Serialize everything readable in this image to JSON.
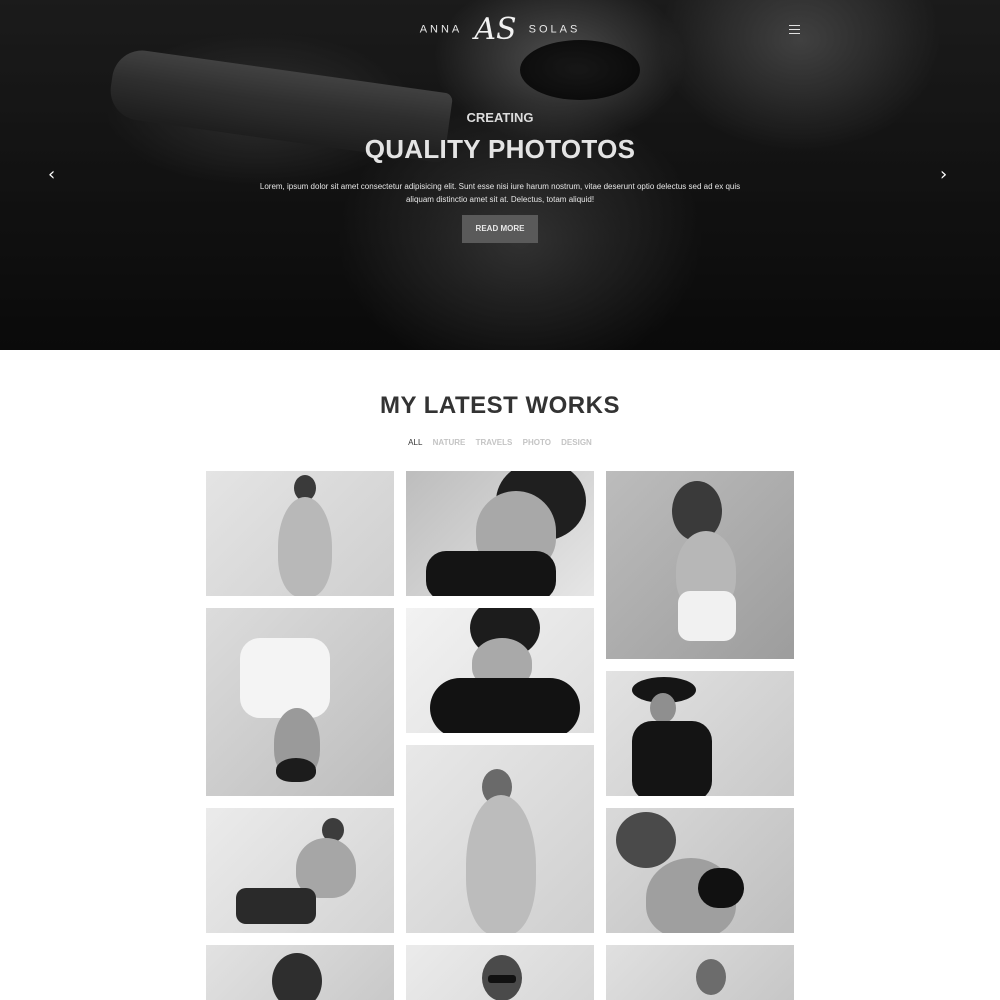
{
  "header": {
    "logo_left": "ANNA",
    "logo_mark": "AS",
    "logo_right": "SOLAS",
    "menu_icon": "hamburger-menu-icon"
  },
  "hero": {
    "subtitle": "CREATING",
    "title": "QUALITY PHOTOTOS",
    "text": "Lorem, ipsum dolor sit amet consectetur adipisicing elit. Sunt esse nisi iure harum nostrum, vitae deserunt optio delectus sed ad ex quis aliquam distinctio amet sit at. Delectus, totam aliquid!",
    "button_label": "READ MORE",
    "prev_icon": "chevron-left-icon",
    "next_icon": "chevron-right-icon"
  },
  "works": {
    "title": "MY LATEST WORKS",
    "filters": [
      "ALL",
      "NATURE",
      "TRAVELS",
      "PHOTO",
      "DESIGN"
    ],
    "active_filter": "ALL"
  },
  "colors": {
    "hero_bg": "#1a1a1a",
    "accent_button": "#5a5a5a",
    "heading": "#333333",
    "filter_inactive": "#c4c4c4"
  }
}
